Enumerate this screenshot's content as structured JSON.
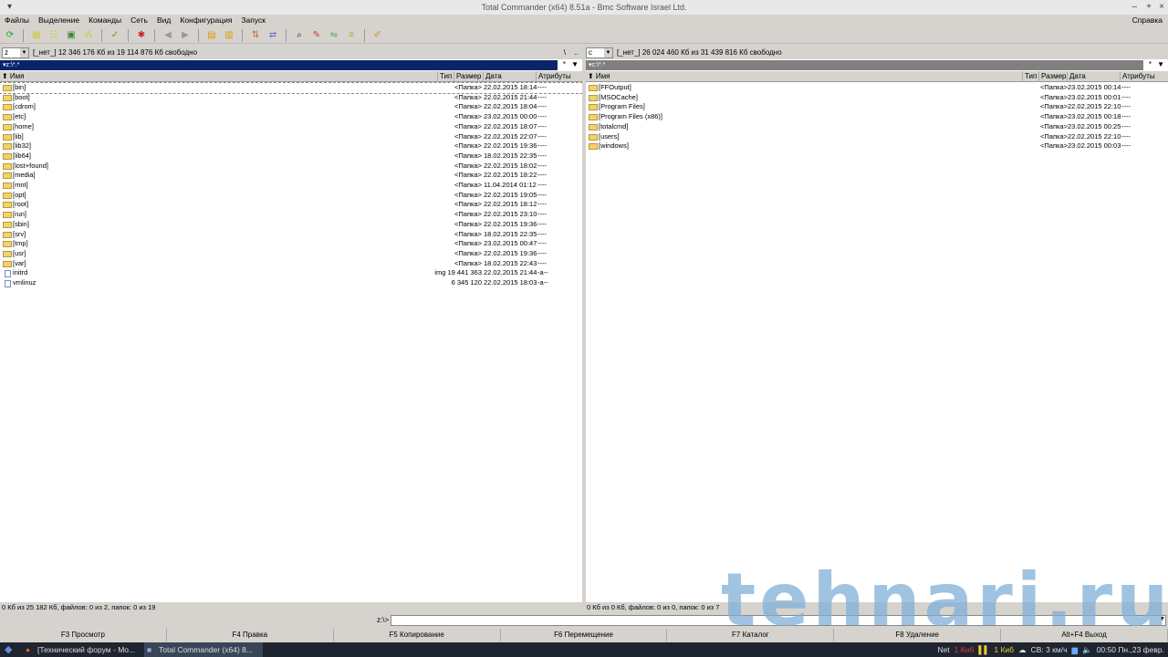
{
  "window": {
    "title": "Total Commander (x64) 8.51a - Bmc Software Israel Ltd.",
    "help": "Справка"
  },
  "menu": [
    "Файлы",
    "Выделение",
    "Команды",
    "Сеть",
    "Вид",
    "Конфигурация",
    "Запуск"
  ],
  "left": {
    "drive": "z",
    "free": "[_нет_]  12 346 176 Кб из 19 114 876 Кб свободно",
    "path": "▾z:\\*.*",
    "status": "0 Кб из 25 182 Кб, файлов: 0 из 2, папок: 0 из 19",
    "files": [
      [
        "[bin]",
        "<Папка>",
        "22.02.2015 18:14",
        "----"
      ],
      [
        "[boot]",
        "<Папка>",
        "22.02.2015 21:44",
        "----"
      ],
      [
        "[cdrom]",
        "<Папка>",
        "22.02.2015 18:04",
        "----"
      ],
      [
        "[etc]",
        "<Папка>",
        "23.02.2015 00:00",
        "----"
      ],
      [
        "[home]",
        "<Папка>",
        "22.02.2015 18:07",
        "----"
      ],
      [
        "[lib]",
        "<Папка>",
        "22.02.2015 22:07",
        "----"
      ],
      [
        "[lib32]",
        "<Папка>",
        "22.02.2015 19:36",
        "----"
      ],
      [
        "[lib64]",
        "<Папка>",
        "18.02.2015 22:35",
        "----"
      ],
      [
        "[lost+found]",
        "<Папка>",
        "22.02.2015 18:02",
        "----"
      ],
      [
        "[media]",
        "<Папка>",
        "22.02.2015 18:22",
        "----"
      ],
      [
        "[mnt]",
        "<Папка>",
        "11.04.2014 01:12",
        "----"
      ],
      [
        "[opt]",
        "<Папка>",
        "22.02.2015 19:05",
        "----"
      ],
      [
        "[root]",
        "<Папка>",
        "22.02.2015 18:12",
        "----"
      ],
      [
        "[run]",
        "<Папка>",
        "22.02.2015 23:10",
        "----"
      ],
      [
        "[sbin]",
        "<Папка>",
        "22.02.2015 19:36",
        "----"
      ],
      [
        "[srv]",
        "<Папка>",
        "18.02.2015 22:35",
        "----"
      ],
      [
        "[tmp]",
        "<Папка>",
        "23.02.2015 00:47",
        "----"
      ],
      [
        "[usr]",
        "<Папка>",
        "22.02.2015 19:36",
        "----"
      ],
      [
        "[var]",
        "<Папка>",
        "18.02.2015 22:43",
        "----"
      ],
      [
        "initrd",
        "img 19 441 363",
        "22.02.2015 21:44",
        "-a--"
      ],
      [
        "vmlinuz",
        "6 345 120",
        "22.02.2015 18:03",
        "-a--"
      ]
    ]
  },
  "right": {
    "drive": "c",
    "free": "[_нет_]  26 024 460 Кб из 31 439 816 Кб свободно",
    "path": "▾c:\\*.*",
    "status": "0 Кб из 0 Кб, файлов: 0 из 0, папок: 0 из 7",
    "files": [
      [
        "[FFOutput]",
        "<Папка>",
        "23.02.2015 00:14",
        "----"
      ],
      [
        "[MSOCache]",
        "<Папка>",
        "23.02.2015 00:01",
        "----"
      ],
      [
        "[Program Files]",
        "<Папка>",
        "22.02.2015 22:10",
        "----"
      ],
      [
        "[Program Files (x86)]",
        "<Папка>",
        "23.02.2015 00:18",
        "----"
      ],
      [
        "[totalcmd]",
        "<Папка>",
        "23.02.2015 00:25",
        "----"
      ],
      [
        "[users]",
        "<Папка>",
        "22.02.2015 22:10",
        "----"
      ],
      [
        "[windows]",
        "<Папка>",
        "23.02.2015 00:03",
        "----"
      ]
    ]
  },
  "columns": {
    "name": "⬆ Имя",
    "type": "Тип",
    "size": "Размер",
    "date": "Дата",
    "attr": "Атрибуты"
  },
  "cmd_prompt": "z:\\>",
  "fkeys": [
    "F3 Просмотр",
    "F4 Правка",
    "F5 Копирование",
    "F6 Перемещение",
    "F7 Каталог",
    "F8 Удаление",
    "Alt+F4 Выход"
  ],
  "taskbar": {
    "tasks": [
      "[Технический форум - Mo...",
      "Total Commander (x64) 8..."
    ],
    "net": "Net",
    "down": "1 Киб",
    "up": "1 Киб",
    "weather": "СВ: 3 км/ч",
    "clock": "00:50 Пн.,23 февр."
  },
  "watermark": "tehnari.ru"
}
